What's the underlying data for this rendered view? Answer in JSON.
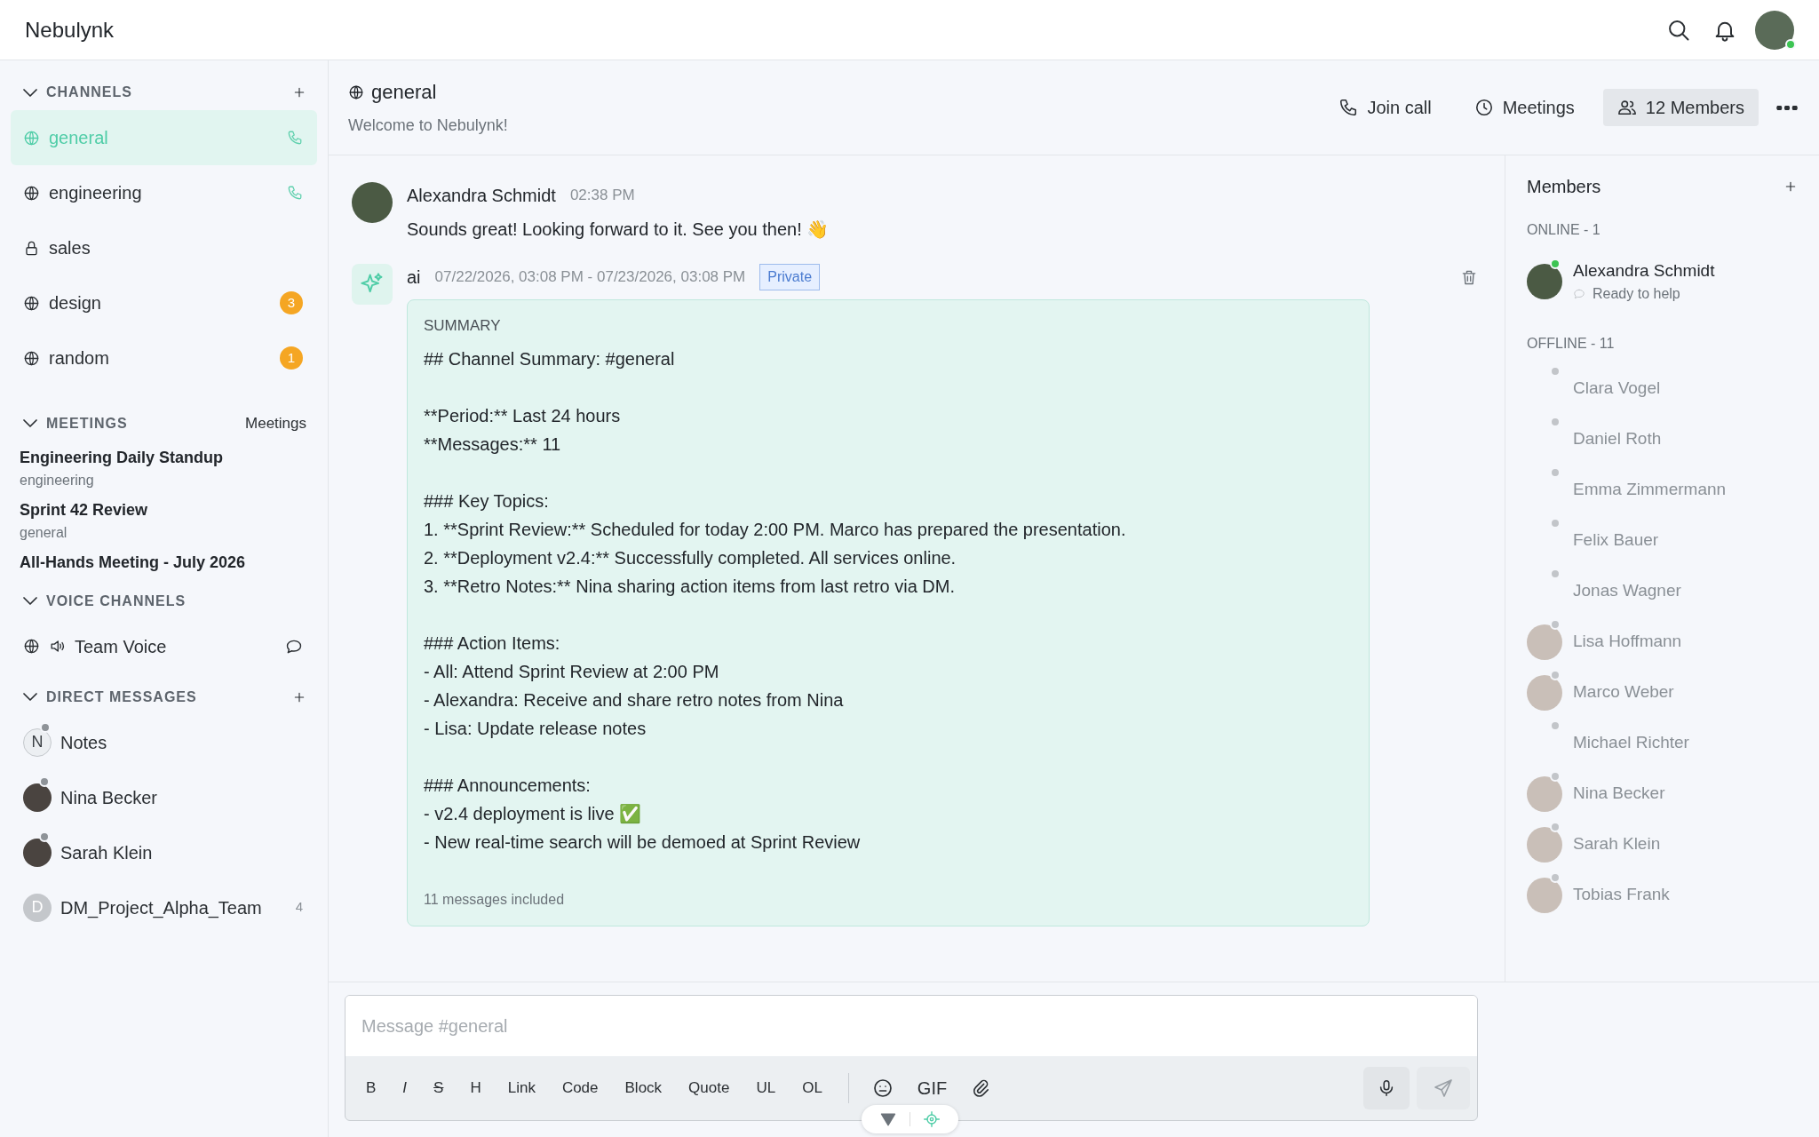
{
  "topbar": {
    "brand": "Nebulynk"
  },
  "sidebar": {
    "channels": {
      "title": "CHANNELS",
      "expanded": true,
      "items": [
        {
          "name": "general",
          "kind": "public",
          "selected": true,
          "call": true
        },
        {
          "name": "engineering",
          "kind": "public",
          "selected": false,
          "call": true
        },
        {
          "name": "sales",
          "kind": "private",
          "selected": false,
          "call": false
        },
        {
          "name": "design",
          "kind": "public",
          "selected": false,
          "call": false,
          "badge": "3"
        },
        {
          "name": "random",
          "kind": "public",
          "selected": false,
          "call": false,
          "badge": "1"
        }
      ]
    },
    "meetings": {
      "title": "MEETINGS",
      "expanded": true,
      "link": "Meetings",
      "items": [
        {
          "title": "Engineering Daily Standup",
          "channel": "engineering"
        },
        {
          "title": "Sprint 42 Review",
          "channel": "general"
        },
        {
          "title": "All-Hands Meeting - July 2026"
        }
      ]
    },
    "voice": {
      "title": "VOICE CHANNELS",
      "expanded": true,
      "items": [
        {
          "name": "Team Voice"
        }
      ]
    },
    "dms": {
      "title": "DIRECT MESSAGES",
      "expanded": true,
      "items": [
        {
          "name": "Notes",
          "kind": "note",
          "initial": "N",
          "online": false
        },
        {
          "name": "Nina Becker",
          "kind": "person",
          "online": false
        },
        {
          "name": "Sarah Klein",
          "kind": "person",
          "online": false
        },
        {
          "name": "DM_Project_Alpha_Team",
          "kind": "group",
          "initial": "D",
          "count": "4"
        }
      ]
    }
  },
  "header": {
    "channel": "general",
    "topic": "Welcome to Nebulynk!",
    "actions": [
      {
        "label": "Join call",
        "kind": "phone",
        "selected": false
      },
      {
        "label": "Meetings",
        "kind": "clock",
        "selected": false
      },
      {
        "label": "12 Members",
        "kind": "people",
        "selected": true
      }
    ]
  },
  "messages": [
    {
      "kind": "user",
      "author": "Alexandra Schmidt",
      "time": "02:38 PM",
      "text": "Sounds great! Looking forward to it. See you then! 👋"
    },
    {
      "kind": "summary",
      "author": "ai",
      "time": "07/22/2026, 03:08 PM - 07/23/2026, 03:08 PM",
      "tag": "Private",
      "heading": "SUMMARY",
      "blocks": [
        [
          "## Channel Summary: #general"
        ],
        [
          "**Period:** Last 24 hours",
          "**Messages:** 11"
        ],
        [
          "### Key Topics:",
          "1. **Sprint Review:** Scheduled for today 2:00 PM. Marco has prepared the presentation.",
          "2. **Deployment v2.4:** Successfully completed. All services online.",
          "3. **Retro Notes:** Nina sharing action items from last retro via DM."
        ],
        [
          "### Action Items:",
          "- All: Attend Sprint Review at 2:00 PM",
          "- Alexandra: Receive and share retro notes from Nina",
          "- Lisa: Update release notes"
        ],
        [
          "### Announcements:",
          "- v2.4 deployment is live ✅",
          "- New real-time search will be demoed at Sprint Review"
        ]
      ],
      "footer": "11 messages included"
    }
  ],
  "members": {
    "title": "Members",
    "groups": [
      {
        "label": "ONLINE - 1",
        "members": [
          {
            "name": "Alexandra Schmidt",
            "online": true,
            "photo": true,
            "status": "Ready to help"
          }
        ]
      },
      {
        "label": "OFFLINE - 11",
        "members": [
          {
            "name": "Clara Vogel",
            "online": false,
            "photo": false
          },
          {
            "name": "Daniel Roth",
            "online": false,
            "photo": false
          },
          {
            "name": "Emma Zimmermann",
            "online": false,
            "photo": false
          },
          {
            "name": "Felix Bauer",
            "online": false,
            "photo": false
          },
          {
            "name": "Jonas Wagner",
            "online": false,
            "photo": false
          },
          {
            "name": "Lisa Hoffmann",
            "online": false,
            "photo": true
          },
          {
            "name": "Marco Weber",
            "online": false,
            "photo": true
          },
          {
            "name": "Michael Richter",
            "online": false,
            "photo": false
          },
          {
            "name": "Nina Becker",
            "online": false,
            "photo": true
          },
          {
            "name": "Sarah Klein",
            "online": false,
            "photo": true
          },
          {
            "name": "Tobias Frank",
            "online": false,
            "photo": true
          }
        ]
      }
    ]
  },
  "composer": {
    "placeholder": "Message #general",
    "format": [
      "B",
      "I",
      "S",
      "H",
      "Link",
      "Code",
      "Block",
      "Quote",
      "UL",
      "OL"
    ],
    "gif": "GIF"
  }
}
